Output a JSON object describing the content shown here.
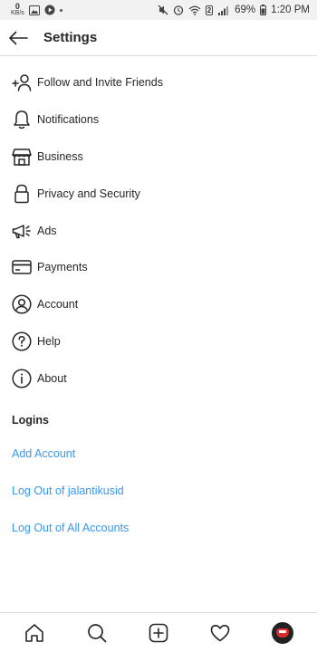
{
  "status_bar": {
    "speed_value": "0",
    "speed_unit": "KB/s",
    "sim_slot": "2",
    "battery": "69%",
    "time": "1:20 PM"
  },
  "header": {
    "title": "Settings"
  },
  "menu": [
    {
      "label": "Follow and Invite Friends",
      "icon": "add-person-icon"
    },
    {
      "label": "Notifications",
      "icon": "bell-icon"
    },
    {
      "label": "Business",
      "icon": "store-icon"
    },
    {
      "label": "Privacy and Security",
      "icon": "lock-icon"
    },
    {
      "label": "Ads",
      "icon": "megaphone-icon"
    },
    {
      "label": "Payments",
      "icon": "credit-card-icon"
    },
    {
      "label": "Account",
      "icon": "account-icon"
    },
    {
      "label": "Help",
      "icon": "help-icon"
    },
    {
      "label": "About",
      "icon": "info-icon"
    }
  ],
  "logins": {
    "title": "Logins",
    "add_account": "Add Account",
    "log_out_user": "Log Out of jalantikusid",
    "log_out_all": "Log Out of All Accounts"
  },
  "bottom_nav": [
    {
      "name": "home",
      "icon": "home-icon"
    },
    {
      "name": "search",
      "icon": "search-icon"
    },
    {
      "name": "new-post",
      "icon": "add-post-icon"
    },
    {
      "name": "activity",
      "icon": "heart-icon"
    },
    {
      "name": "profile",
      "icon": "avatar"
    }
  ],
  "colors": {
    "link": "#3897f0",
    "text": "#262626",
    "status_bar_bg": "#f2f2f2"
  }
}
